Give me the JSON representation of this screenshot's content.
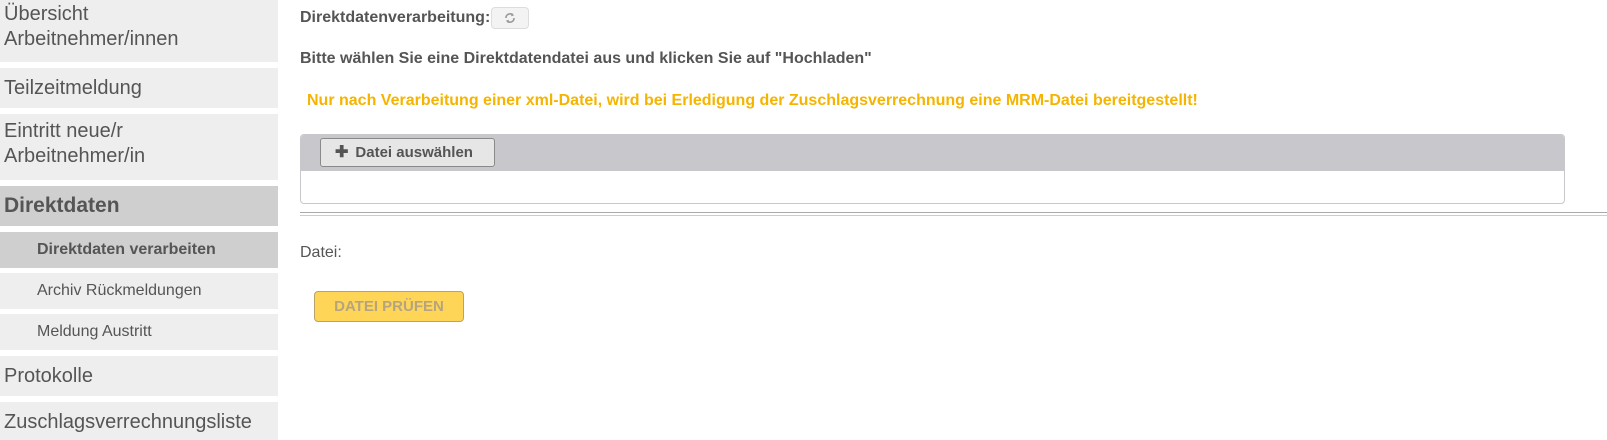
{
  "sidebar": {
    "items": [
      {
        "line1": "Übersicht",
        "line2": "Arbeitnehmer/innen"
      },
      {
        "label": "Teilzeitmeldung"
      },
      {
        "line1": "Eintritt neue/r",
        "line2": "Arbeitnehmer/in"
      },
      {
        "label": "Direktdaten"
      },
      {
        "label": "Direktdaten verarbeiten"
      },
      {
        "label": "Archiv Rückmeldungen"
      },
      {
        "label": "Meldung Austritt"
      },
      {
        "label": "Protokolle"
      },
      {
        "label": "Zuschlagsverrechnungsliste"
      }
    ]
  },
  "main": {
    "title": "Direktdatenverarbeitung:",
    "refresh_icon": "refresh-icon",
    "instruction": "Bitte wählen Sie eine Direktdatendatei aus und klicken Sie auf \"Hochladen\"",
    "warning": "Nur nach Verarbeitung einer xml-Datei, wird bei Erledigung der Zuschlagsverrechnung eine MRM-Datei bereitgestellt!",
    "choose_file_label": "Datei auswählen",
    "file_label": "Datei:",
    "check_button_label": "DATEI PRÜFEN"
  },
  "colors": {
    "warning": "#f5b400",
    "accent_button": "#ffd557",
    "sidebar_bg": "#eeeeee",
    "sidebar_active_bg": "#cfcfcf"
  }
}
